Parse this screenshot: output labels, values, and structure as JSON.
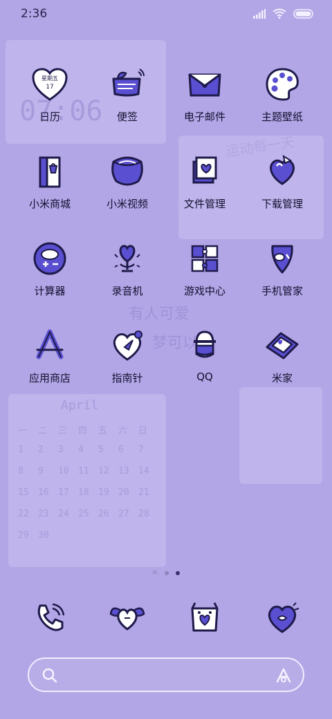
{
  "status_bar": {
    "time": "2:36",
    "icons": [
      "signal-icon",
      "wifi-icon",
      "battery-icon"
    ]
  },
  "apps": [
    {
      "label": "日历",
      "icon": "calendar-icon",
      "calendar_weekday": "星期五",
      "calendar_day": "17"
    },
    {
      "label": "便签",
      "icon": "notes-icon"
    },
    {
      "label": "电子邮件",
      "icon": "email-icon"
    },
    {
      "label": "主题壁纸",
      "icon": "palette-icon"
    },
    {
      "label": "小米商城",
      "icon": "store-icon"
    },
    {
      "label": "小米视频",
      "icon": "video-icon"
    },
    {
      "label": "文件管理",
      "icon": "files-icon"
    },
    {
      "label": "下载管理",
      "icon": "download-icon"
    },
    {
      "label": "计算器",
      "icon": "calculator-icon"
    },
    {
      "label": "录音机",
      "icon": "recorder-icon"
    },
    {
      "label": "游戏中心",
      "icon": "game-center-icon"
    },
    {
      "label": "手机管家",
      "icon": "security-icon"
    },
    {
      "label": "应用商店",
      "icon": "app-store-icon"
    },
    {
      "label": "指南针",
      "icon": "compass-icon"
    },
    {
      "label": "QQ",
      "icon": "qq-icon"
    },
    {
      "label": "米家",
      "icon": "mi-home-icon"
    }
  ],
  "pager": {
    "pages": 3,
    "active": 3
  },
  "dock": [
    {
      "icon": "phone-icon"
    },
    {
      "icon": "messages-icon"
    },
    {
      "icon": "browser-icon"
    },
    {
      "icon": "camera-icon"
    }
  ],
  "search": {
    "placeholder": ""
  },
  "colors": {
    "background": "#b3a6e6",
    "icon_fill": "#5a4fd0",
    "icon_stroke": "#1e1a4a"
  },
  "wallpaper": {
    "clock": "07:06",
    "month": "April",
    "week": [
      "一",
      "二",
      "三",
      "四",
      "五",
      "六",
      "日"
    ],
    "days": [
      "1",
      "2",
      "3",
      "4",
      "5",
      "6",
      "7",
      "8",
      "9",
      "10",
      "11",
      "12",
      "13",
      "14",
      "15",
      "16",
      "17",
      "18",
      "19",
      "20",
      "21",
      "22",
      "23",
      "24",
      "25",
      "26",
      "27",
      "28",
      "29",
      "30"
    ],
    "slogan": "运动每一天",
    "phrase1": "有人可爱",
    "phrase2": "梦可以"
  }
}
